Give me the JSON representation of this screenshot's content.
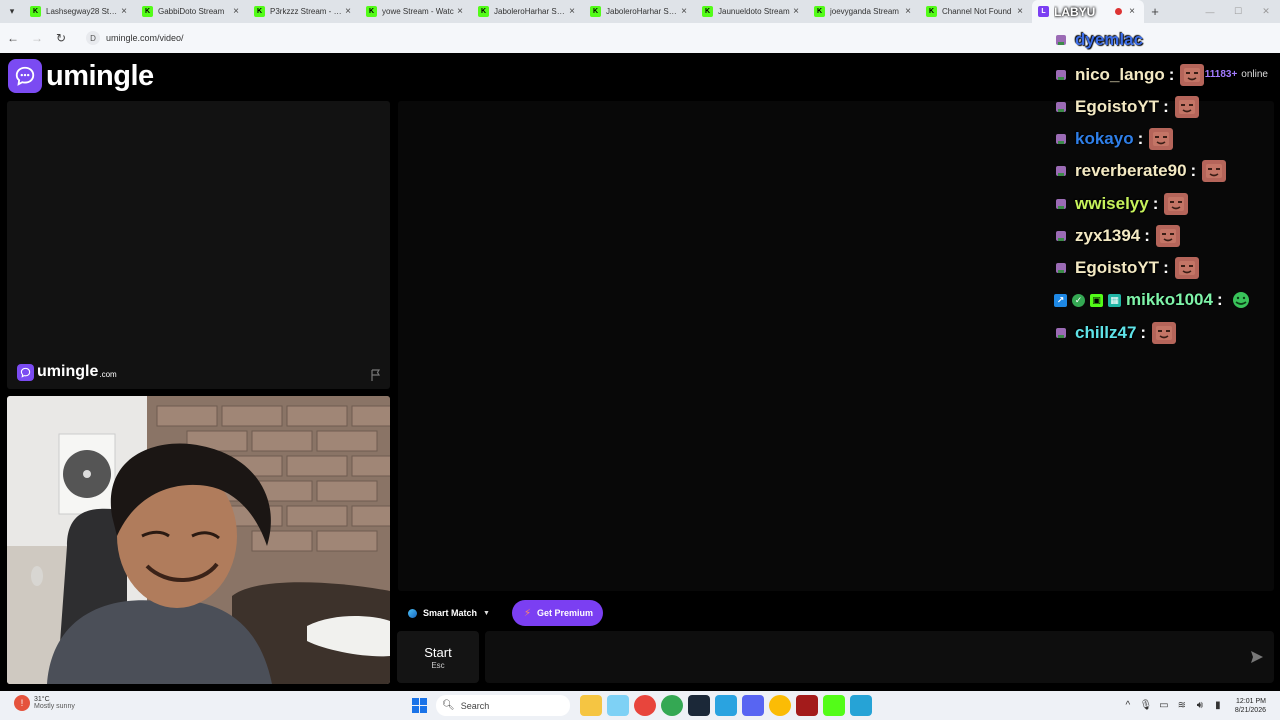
{
  "browser": {
    "tabs": [
      {
        "label": "Lashsegway28 Strea",
        "active": false
      },
      {
        "label": "GabbiDoto Stream",
        "active": false
      },
      {
        "label": "P3rkzzz Stream - Wa",
        "active": false
      },
      {
        "label": "yowe Stream - Watc",
        "active": false
      },
      {
        "label": "JaboleroHarhar Stre",
        "active": false
      },
      {
        "label": "JaboleroHarhar Stre",
        "active": false
      },
      {
        "label": "Jaunueldoto Stream",
        "active": false
      },
      {
        "label": "joevyganda Stream",
        "active": false
      },
      {
        "label": "Channel Not Found",
        "active": false
      }
    ],
    "active_tab_label": "LABYU",
    "new_tab_symbol": "+",
    "url": "umingle.com/video/",
    "profile_initial": "J"
  },
  "site": {
    "logo_text": "umingle",
    "online_count": "11183+",
    "online_label": "online",
    "watermark_text": "umingle",
    "watermark_domain": ".com",
    "smart_match_label": "Smart Match",
    "premium_label": "Get Premium",
    "start_label": "Start",
    "start_hint": "Esc",
    "message_placeholder": ""
  },
  "stream_chat": {
    "header_name": "dyemlac",
    "messages": [
      {
        "name": "nico_lango",
        "color": "#f3e9c3",
        "sep": ":",
        "emote": "face"
      },
      {
        "name": "EgoistoYT",
        "color": "#f3e9c3",
        "sep": ":",
        "emote": "face"
      },
      {
        "name": "kokayo",
        "color": "#2f7fe8",
        "sep": ":",
        "emote": "face"
      },
      {
        "name": "reverberate90",
        "color": "#f3e9c3",
        "sep": ":",
        "emote": "face"
      },
      {
        "name": "wwiselyy",
        "color": "#c6f25b",
        "sep": ":",
        "emote": "face"
      },
      {
        "name": "zyx1394",
        "color": "#f3e9c3",
        "sep": ":",
        "emote": "face"
      },
      {
        "name": "EgoistoYT",
        "color": "#f3e9c3",
        "sep": ":",
        "emote": "face"
      },
      {
        "name": "mikko1004",
        "color": "#7ef3a8",
        "sep": ":",
        "emote": "green"
      },
      {
        "name": "chillz47",
        "color": "#5fe3e8",
        "sep": ":",
        "emote": "face"
      }
    ]
  },
  "taskbar": {
    "weather_temp": "31°C",
    "weather_condition": "Mostly sunny",
    "search_label": "Search",
    "time": "12:01 PM",
    "date": "8/21/2026"
  },
  "colors": {
    "brand_purple": "#7b4bf2",
    "premium_purple": "#7b3ff2",
    "kick_green": "#53fc18"
  }
}
